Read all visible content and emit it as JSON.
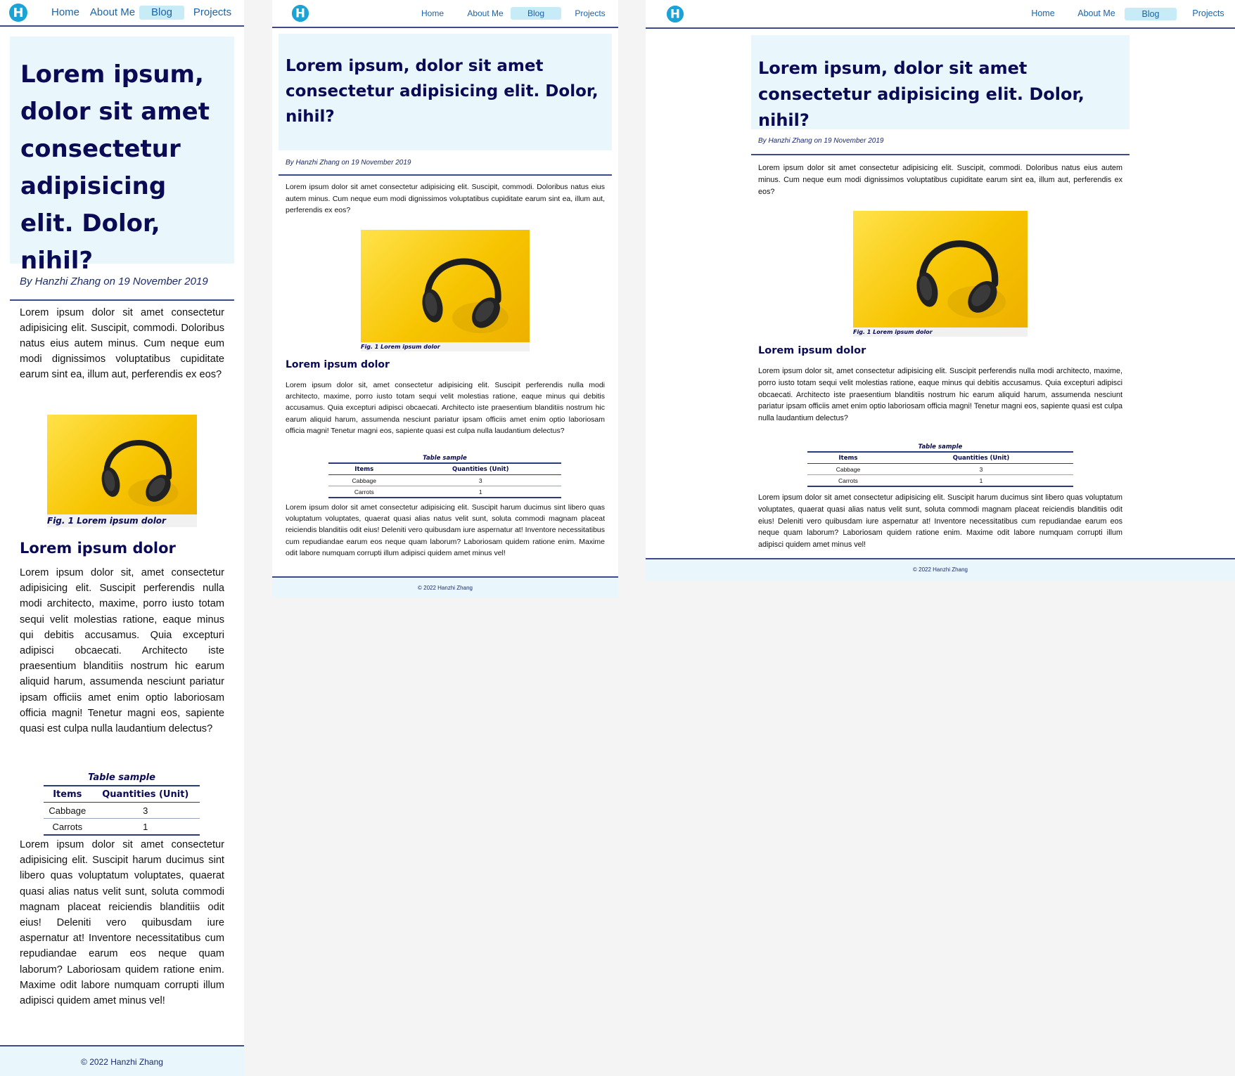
{
  "site": {
    "logo_letter": "H",
    "nav": [
      {
        "label": "Home",
        "active": false
      },
      {
        "label": "About Me",
        "active": false
      },
      {
        "label": "Blog",
        "active": true
      },
      {
        "label": "Projects",
        "active": false
      }
    ]
  },
  "article": {
    "title": "Lorem ipsum, dolor sit amet consectetur adipisicing elit. Dolor, nihil?",
    "byline": "By Hanzhi Zhang on 19 November 2019",
    "intro": "Lorem ipsum dolor sit amet consectetur adipisicing elit. Suscipit, commodi. Doloribus natus eius autem minus. Cum neque eum modi dignissimos voluptatibus cupiditate earum sint ea, illum aut, perferendis ex eos?",
    "figure_caption": "Fig. 1 Lorem ipsum dolor",
    "subheading": "Lorem ipsum dolor",
    "body": "Lorem ipsum dolor sit, amet consectetur adipisicing elit. Suscipit perferendis nulla modi architecto, maxime, porro iusto totam sequi velit molestias ratione, eaque minus qui debitis accusamus. Quia excepturi adipisci obcaecati. Architecto iste praesentium blanditiis nostrum hic earum aliquid harum, assumenda nesciunt pariatur ipsam officiis amet enim optio laboriosam officia magni! Tenetur magni eos, sapiente quasi est culpa nulla laudantium delectus?",
    "table": {
      "caption": "Table sample",
      "headers": [
        "Items",
        "Quantities (Unit)"
      ],
      "rows": [
        [
          "Cabbage",
          "3"
        ],
        [
          "Carrots",
          "1"
        ]
      ]
    },
    "closing": "Lorem ipsum dolor sit amet consectetur adipisicing elit. Suscipit harum ducimus sint libero quas voluptatum voluptates, quaerat quasi alias natus velit sunt, soluta commodi magnam placeat reiciendis blanditiis odit eius! Deleniti vero quibusdam iure aspernatur at! Inventore necessitatibus cum repudiandae earum eos neque quam laborum? Laboriosam quidem ratione enim. Maxime odit labore numquam corrupti illum adipisci quidem amet minus vel!"
  },
  "footer": {
    "text": "© 2022 Hanzhi Zhang"
  },
  "colors": {
    "accent": "#0a0a55",
    "nav_link": "#1c63a8",
    "active_tab": "#c7ecf8",
    "title_bg": "#e9f7fc",
    "logo": "#1aa3d4"
  }
}
